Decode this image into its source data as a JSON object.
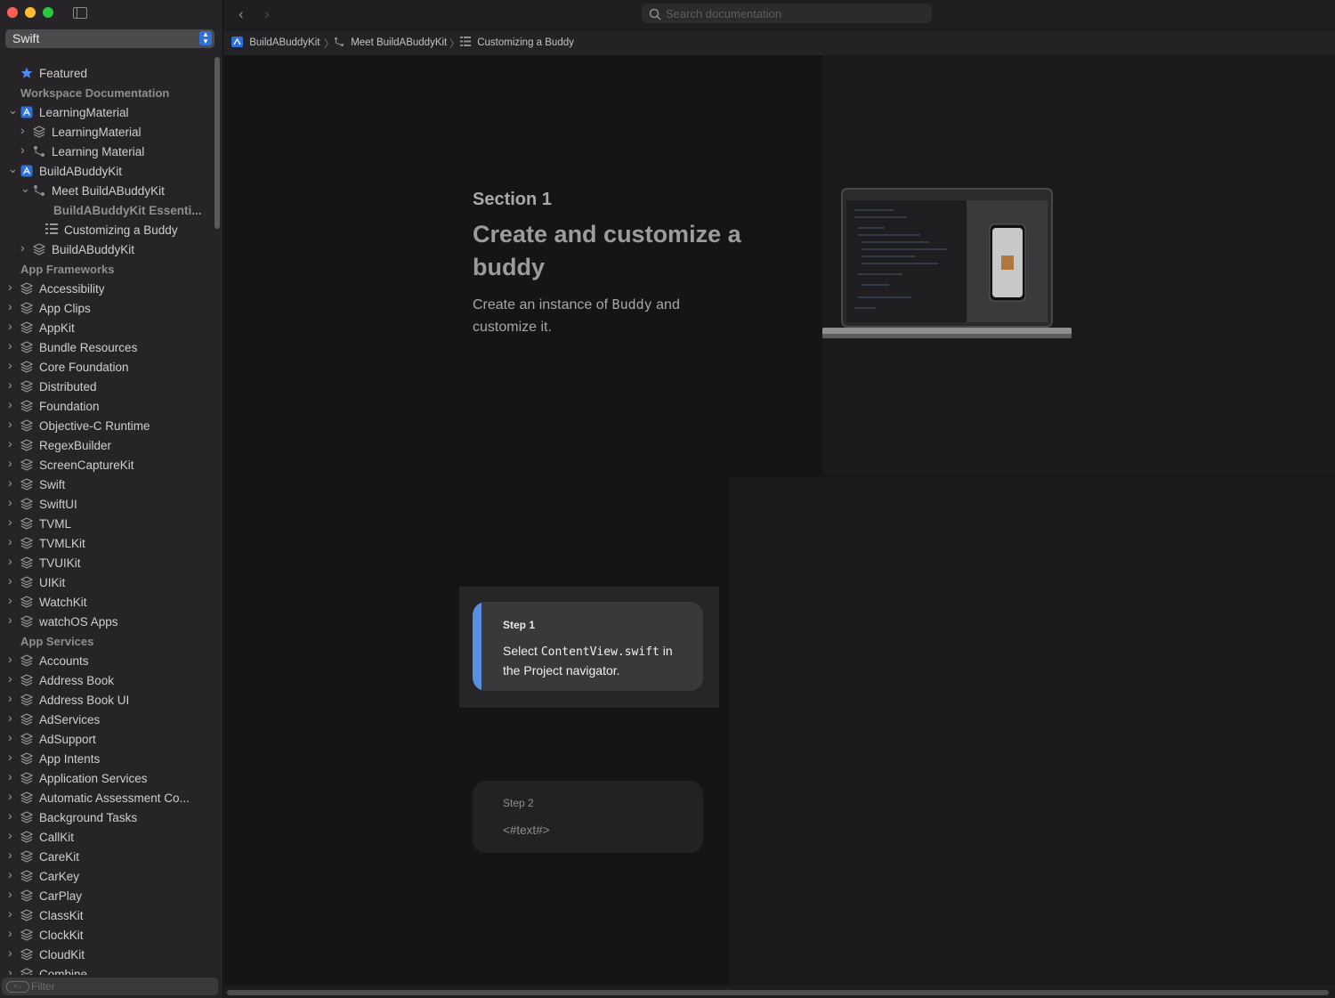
{
  "colors": {
    "close": "#ff5f57",
    "minimize": "#febc2e",
    "zoom": "#28c840",
    "accent_blue": "#2f6fd8",
    "step_accent": "#5a8ee0"
  },
  "sidebar": {
    "language": "Swift",
    "filter_placeholder": "Filter",
    "items": [
      {
        "label": "Featured",
        "kind": "star",
        "indent": 0,
        "chevron": "",
        "style": "normal"
      },
      {
        "label": "Workspace Documentation",
        "kind": "header",
        "indent": 0,
        "chevron": "",
        "style": "header"
      },
      {
        "label": "LearningMaterial",
        "kind": "app",
        "indent": 0,
        "chevron": "down",
        "style": "normal"
      },
      {
        "label": "LearningMaterial",
        "kind": "stack",
        "indent": 1,
        "chevron": "right",
        "style": "normal"
      },
      {
        "label": "Learning Material",
        "kind": "tutorial",
        "indent": 1,
        "chevron": "right",
        "style": "normal"
      },
      {
        "label": "BuildABuddyKit",
        "kind": "app",
        "indent": 0,
        "chevron": "down",
        "style": "normal"
      },
      {
        "label": "Meet BuildABuddyKit",
        "kind": "tutorial",
        "indent": 1,
        "chevron": "down",
        "style": "normal"
      },
      {
        "label": "BuildABuddyKit Essenti...",
        "kind": "none",
        "indent": 2,
        "chevron": "",
        "style": "dim"
      },
      {
        "label": "Customizing a Buddy",
        "kind": "list",
        "indent": 2,
        "chevron": "",
        "style": "normal"
      },
      {
        "label": "BuildABuddyKit",
        "kind": "stack",
        "indent": 1,
        "chevron": "right",
        "style": "normal"
      },
      {
        "label": "App Frameworks",
        "kind": "header",
        "indent": 0,
        "chevron": "",
        "style": "header"
      },
      {
        "label": "Accessibility",
        "kind": "stack",
        "indent": 0,
        "chevron": "right",
        "style": "normal"
      },
      {
        "label": "App Clips",
        "kind": "stack",
        "indent": 0,
        "chevron": "right",
        "style": "normal"
      },
      {
        "label": "AppKit",
        "kind": "stack",
        "indent": 0,
        "chevron": "right",
        "style": "normal"
      },
      {
        "label": "Bundle Resources",
        "kind": "stack",
        "indent": 0,
        "chevron": "right",
        "style": "normal"
      },
      {
        "label": "Core Foundation",
        "kind": "stack",
        "indent": 0,
        "chevron": "right",
        "style": "normal"
      },
      {
        "label": "Distributed",
        "kind": "stack",
        "indent": 0,
        "chevron": "right",
        "style": "normal"
      },
      {
        "label": "Foundation",
        "kind": "stack",
        "indent": 0,
        "chevron": "right",
        "style": "normal"
      },
      {
        "label": "Objective-C Runtime",
        "kind": "stack",
        "indent": 0,
        "chevron": "right",
        "style": "normal"
      },
      {
        "label": "RegexBuilder",
        "kind": "stack",
        "indent": 0,
        "chevron": "right",
        "style": "normal"
      },
      {
        "label": "ScreenCaptureKit",
        "kind": "stack",
        "indent": 0,
        "chevron": "right",
        "style": "normal"
      },
      {
        "label": "Swift",
        "kind": "stack",
        "indent": 0,
        "chevron": "right",
        "style": "normal"
      },
      {
        "label": "SwiftUI",
        "kind": "stack",
        "indent": 0,
        "chevron": "right",
        "style": "normal"
      },
      {
        "label": "TVML",
        "kind": "stack",
        "indent": 0,
        "chevron": "right",
        "style": "normal"
      },
      {
        "label": "TVMLKit",
        "kind": "stack",
        "indent": 0,
        "chevron": "right",
        "style": "normal"
      },
      {
        "label": "TVUIKit",
        "kind": "stack",
        "indent": 0,
        "chevron": "right",
        "style": "normal"
      },
      {
        "label": "UIKit",
        "kind": "stack",
        "indent": 0,
        "chevron": "right",
        "style": "normal"
      },
      {
        "label": "WatchKit",
        "kind": "stack",
        "indent": 0,
        "chevron": "right",
        "style": "normal"
      },
      {
        "label": "watchOS Apps",
        "kind": "stack",
        "indent": 0,
        "chevron": "right",
        "style": "normal"
      },
      {
        "label": "App Services",
        "kind": "header",
        "indent": 0,
        "chevron": "",
        "style": "header"
      },
      {
        "label": "Accounts",
        "kind": "stack",
        "indent": 0,
        "chevron": "right",
        "style": "normal"
      },
      {
        "label": "Address Book",
        "kind": "stack",
        "indent": 0,
        "chevron": "right",
        "style": "normal"
      },
      {
        "label": "Address Book UI",
        "kind": "stack",
        "indent": 0,
        "chevron": "right",
        "style": "normal"
      },
      {
        "label": "AdServices",
        "kind": "stack",
        "indent": 0,
        "chevron": "right",
        "style": "normal"
      },
      {
        "label": "AdSupport",
        "kind": "stack",
        "indent": 0,
        "chevron": "right",
        "style": "normal"
      },
      {
        "label": "App Intents",
        "kind": "stack",
        "indent": 0,
        "chevron": "right",
        "style": "normal"
      },
      {
        "label": "Application Services",
        "kind": "stack",
        "indent": 0,
        "chevron": "right",
        "style": "normal"
      },
      {
        "label": "Automatic Assessment Co...",
        "kind": "stack",
        "indent": 0,
        "chevron": "right",
        "style": "normal"
      },
      {
        "label": "Background Tasks",
        "kind": "stack",
        "indent": 0,
        "chevron": "right",
        "style": "normal"
      },
      {
        "label": "CallKit",
        "kind": "stack",
        "indent": 0,
        "chevron": "right",
        "style": "normal"
      },
      {
        "label": "CareKit",
        "kind": "stack",
        "indent": 0,
        "chevron": "right",
        "style": "normal"
      },
      {
        "label": "CarKey",
        "kind": "stack",
        "indent": 0,
        "chevron": "right",
        "style": "normal"
      },
      {
        "label": "CarPlay",
        "kind": "stack",
        "indent": 0,
        "chevron": "right",
        "style": "normal"
      },
      {
        "label": "ClassKit",
        "kind": "stack",
        "indent": 0,
        "chevron": "right",
        "style": "normal"
      },
      {
        "label": "ClockKit",
        "kind": "stack",
        "indent": 0,
        "chevron": "right",
        "style": "normal"
      },
      {
        "label": "CloudKit",
        "kind": "stack",
        "indent": 0,
        "chevron": "right",
        "style": "normal"
      },
      {
        "label": "Combine",
        "kind": "stack",
        "indent": 0,
        "chevron": "right",
        "style": "normal"
      }
    ]
  },
  "toolbar": {
    "search_placeholder": "Search documentation"
  },
  "breadcrumb": {
    "items": [
      "BuildABuddyKit",
      "Meet BuildABuddyKit",
      "Customizing a Buddy"
    ]
  },
  "section": {
    "label": "Section 1",
    "title": "Create and customize a buddy",
    "desc_prefix": "Create an instance of",
    "desc_code": "Buddy",
    "desc_suffix": "and customize it."
  },
  "steps": [
    {
      "title": "Step 1",
      "body_prefix": "Select",
      "body_code": "ContentView.swift",
      "body_suffix": "in the Project navigator."
    },
    {
      "title": "Step 2",
      "body": "<#text#>"
    }
  ]
}
